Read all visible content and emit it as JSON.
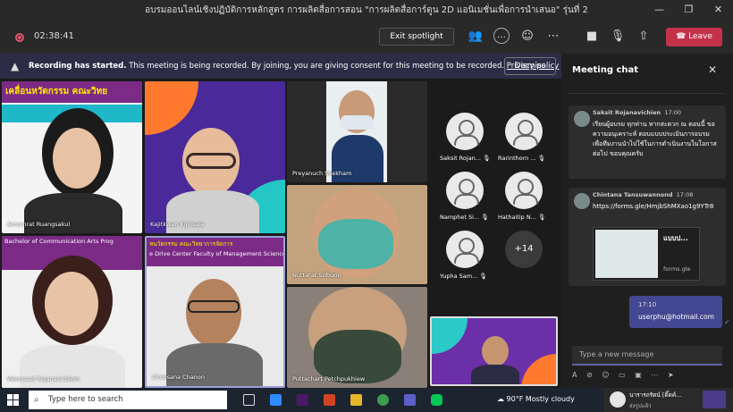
{
  "window": {
    "title": "อบรมออนไลน์เชิงปฏิบัติการหลักสูตร การผลิตสื่อการสอน \"การผลิตสื่อการ์ตูน 2D แอนิเมชั่นเพื่อการนำเสนอ\" รุ่นที่ 2",
    "minimize": "—",
    "maximize": "❐",
    "close": "✕"
  },
  "toolbar": {
    "timer": "02:38:41",
    "exit_spotlight": "Exit spotlight",
    "leave": "Leave"
  },
  "banner": {
    "bold": "Recording has started.",
    "text": "This meeting is being recorded. By joining, you are giving consent for this meeting to be recorded.",
    "link": "Privacy policy",
    "dismiss": "Dismiss"
  },
  "participants": [
    {
      "name": "Amornrat Ruangsakul"
    },
    {
      "name": "Kajitkwan Kijvisala"
    },
    {
      "name": "Preyanuch Seekham"
    },
    {
      "name": "Nuttarat Sriburin"
    },
    {
      "name": "Wannarat Rojanavichiem"
    },
    {
      "name": "Choosana Chanon"
    },
    {
      "name": "Puttachart Petchpukhiew"
    }
  ],
  "banner_texts": {
    "top_left": "เคลื่อนหวัตกรรม คณะวิทย",
    "uni": "Bachelor of Communication Arts Prog",
    "ctr": "หนวัตกรรม คณะวิทยาการจัดการ",
    "ctr2": "e Drive Center  Faculty of Management Science"
  },
  "audio_only": [
    {
      "name": "Saksit Rojan..."
    },
    {
      "name": "Rarinthorn ..."
    },
    {
      "name": "Namphet Si..."
    },
    {
      "name": "Hathaitip N..."
    },
    {
      "name": "Yupha Sam..."
    }
  ],
  "overflow": "+14",
  "chat": {
    "title": "Meeting chat",
    "messages": [
      {
        "sender": "Saksit Rojanavichien",
        "time": "17:00",
        "text": "เรียนผู้อบรม ทุกท่าน หากสะดวก ณ ตอนนี้ ขอความอนุเคราะห์ ตอบแบบประเมินการอบรม เพื่อทีมงานนำไปใช้ในการดำเนินงานในโอกาสต่อไป ขอบคุณครับ"
      },
      {
        "sender": "Chintana Tansuwannond",
        "time": "17:08",
        "link": "https://forms.gle/HmjbShMXao1g9YTr8",
        "preview_title": "แบบป...",
        "preview_site": "forms.gle"
      }
    ],
    "mine": {
      "time": "17:10",
      "text": "userphu@hotmail.com"
    },
    "compose_placeholder": "Type a new message"
  },
  "taskbar": {
    "search": "Type here to search",
    "weather": "90°F  Mostly cloudy",
    "notif_title": "นารารถรัตน์ [ดิ๊ดค์...",
    "notif_sub": "ส่งรูปแล้ว"
  },
  "colors": {
    "accent": "#6264a7",
    "leave": "#c4314b",
    "banner_bg": "#2d2c47"
  }
}
